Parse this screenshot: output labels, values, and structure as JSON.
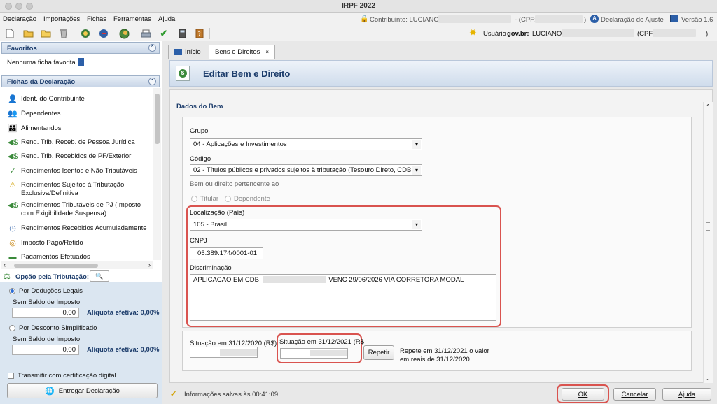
{
  "window": {
    "title": "IRPF 2022"
  },
  "menu": {
    "items": [
      "Declaração",
      "Importações",
      "Fichas",
      "Ferramentas",
      "Ajuda"
    ]
  },
  "header_info": {
    "contribuinte_label": "Contribuinte: LUCIANO",
    "cpf_label": "- (CPF:",
    "cpf_close": ")",
    "declaracao_label": "Declaração de Ajuste",
    "versao_label": "Versão 1.6",
    "usuario_label": "Usuário",
    "usuario_govbr": "gov.br:",
    "usuario_name": "LUCIANO",
    "usuario_cpf_label": "(CPF",
    "usuario_cpf_close": ")"
  },
  "toolbar": {
    "icons": [
      "new-file-icon",
      "open-folder-icon",
      "folder-icon",
      "trash-icon",
      "transmit-icon",
      "receive-icon",
      "globe-icon",
      "print-icon",
      "check-icon",
      "calculator-icon",
      "book-icon"
    ]
  },
  "sidebar": {
    "favoritos_title": "Favoritos",
    "favoritos_empty": "Nenhuma ficha favorita",
    "fichas_title": "Fichas da Declaração",
    "items": [
      "Ident. do Contribuinte",
      "Dependentes",
      "Alimentandos",
      "Rend. Trib. Receb. de Pessoa Jurídica",
      "Rend. Trib. Recebidos de PF/Exterior",
      "Rendimentos Isentos e Não Tributáveis",
      "Rendimentos Sujeitos à Tributação Exclusiva/Definitiva",
      "Rendimentos Tributáveis de PJ (Imposto com Exigibilidade Suspensa)",
      "Rendimentos Recebidos Acumuladamente",
      "Imposto Pago/Retido",
      "Pagamentos Efetuados"
    ]
  },
  "tributacao": {
    "title": "Opção pela Tributação:",
    "deducoes_label": "Por Deduções Legais",
    "deducoes_saldo_label": "Sem Saldo de Imposto",
    "deducoes_value": "0,00",
    "deducoes_aliquota": "Alíquota efetiva: 0,00%",
    "simplificado_label": "Por Desconto Simplificado",
    "simplificado_saldo_label": "Sem Saldo de Imposto",
    "simplificado_value": "0,00",
    "simplificado_aliquota": "Alíquota efetiva: 0,00%",
    "selected": "deducoes",
    "certificado_label": "Transmitir com certificação digital",
    "entregar_label": "Entregar Declaração"
  },
  "tabs": [
    {
      "label": "Início",
      "active": false
    },
    {
      "label": "Bens e Direitos",
      "active": true,
      "close": "×"
    }
  ],
  "editor": {
    "title": "Editar Bem e Direito",
    "section_title": "Dados do Bem",
    "grupo_label": "Grupo",
    "grupo_value": "04 - Aplicações e Investimentos",
    "codigo_label": "Código",
    "codigo_value": "02 - Títulos públicos e privados sujeitos à tributação (Tesouro Direto, CDB,",
    "pertencente_label": "Bem ou direito pertencente ao",
    "titular_label": "Titular",
    "dependente_label": "Dependente",
    "localizacao_label": "Localização (País)",
    "localizacao_value": "105 - Brasil",
    "cnpj_label": "CNPJ",
    "cnpj_value": "05.389.174/0001-01",
    "discriminacao_label": "Discriminação",
    "discriminacao_prefix": "APLICACAO EM CDB",
    "discriminacao_suffix": "VENC 29/06/2026 VIA CORRETORA MODAL",
    "situacao_2020_label": "Situação em 31/12/2020 (R$)",
    "situacao_2021_label": "Situação em 31/12/2021 (R$",
    "repetir_label": "Repetir",
    "repete_text_1": "Repete em 31/12/2021 o valor",
    "repete_text_2": "em reais de 31/12/2020"
  },
  "status": {
    "saved_text": "Informações salvas às 00:41:09."
  },
  "buttons": {
    "ok": "OK",
    "cancelar": "Cancelar",
    "ajuda": "Ajuda"
  }
}
